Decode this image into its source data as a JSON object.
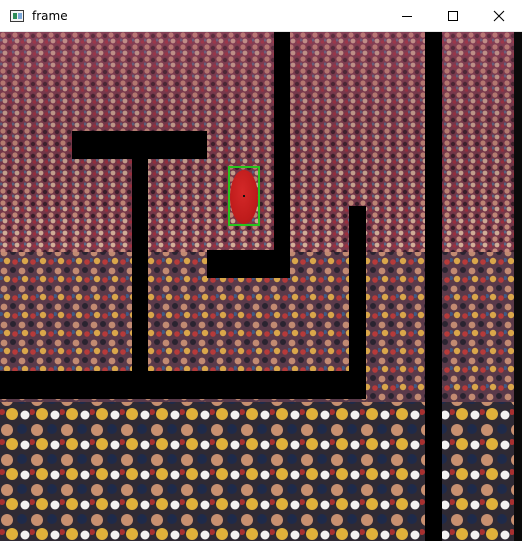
{
  "window": {
    "title": "frame",
    "icon": "app-window-icon",
    "controls": [
      "minimize-icon",
      "maximize-icon",
      "close-icon"
    ]
  },
  "scene": {
    "background": "crowd-photo",
    "palette": {
      "wall": "#000000",
      "detected_object": "#c8201f",
      "bounding_box": "#27c41d"
    }
  }
}
